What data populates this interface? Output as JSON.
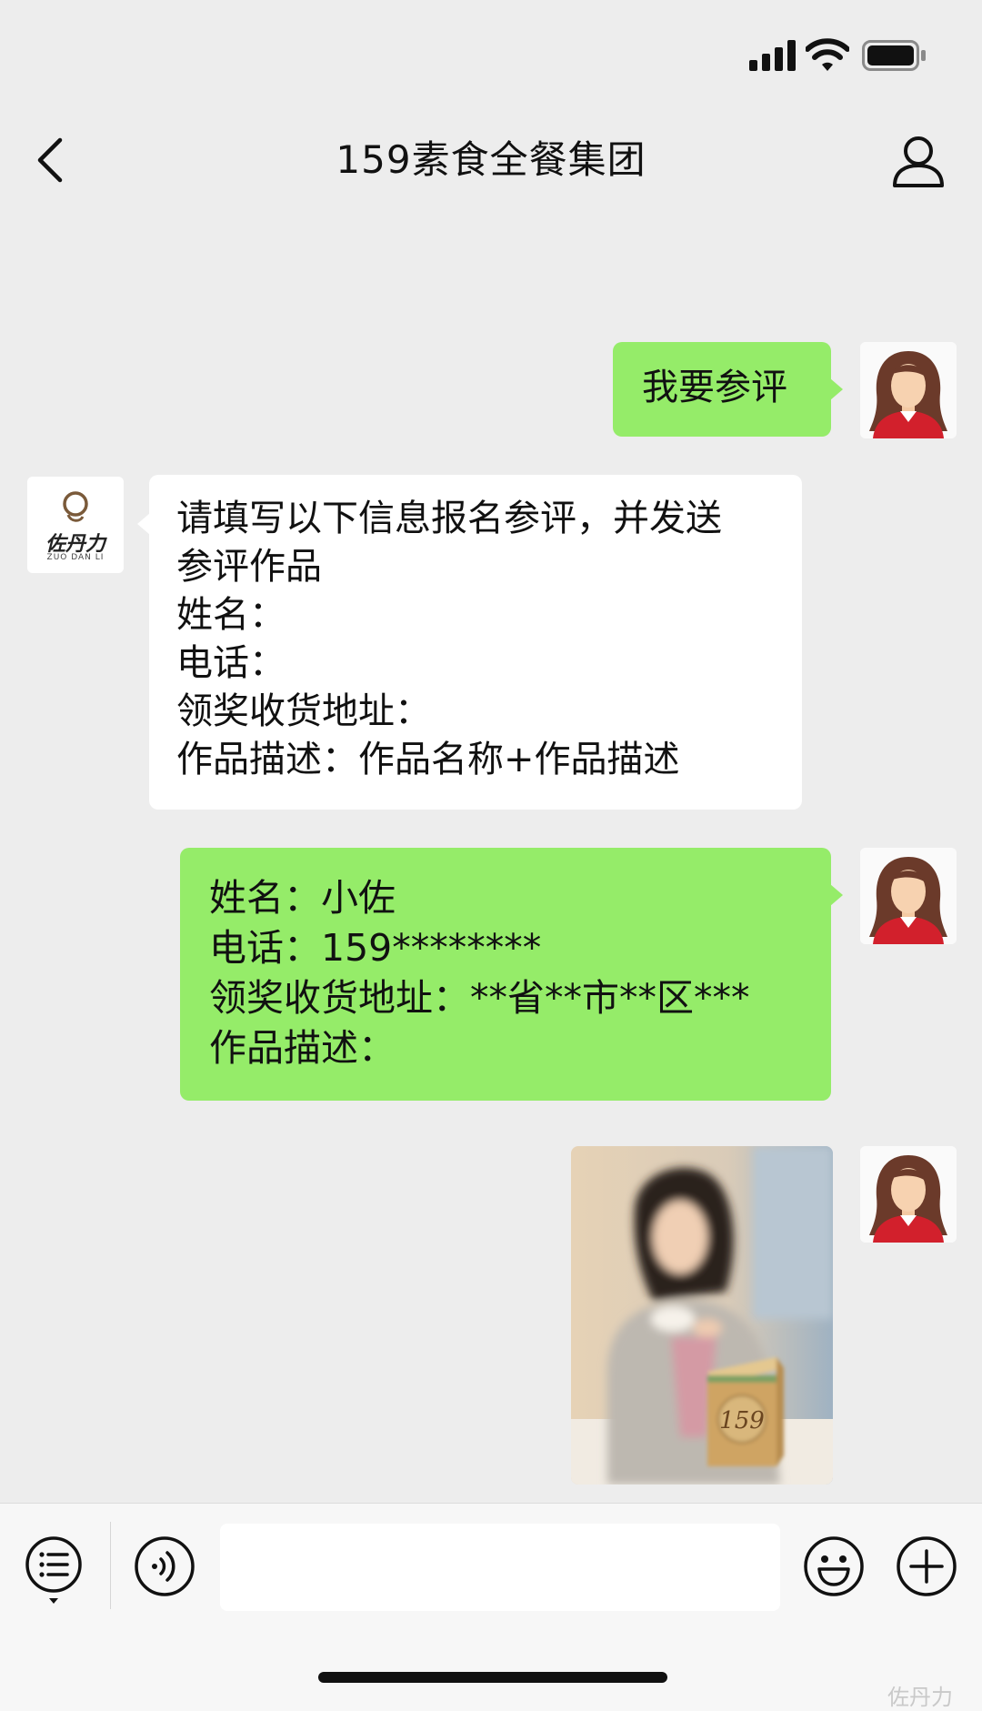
{
  "status_bar": {
    "signal": "signal-icon",
    "wifi": "wifi-icon",
    "battery": "battery-icon"
  },
  "header": {
    "title": "159素食全餐集团",
    "back_icon": "chevron-left-icon",
    "profile_icon": "person-icon"
  },
  "brand_avatar": {
    "text": "佐丹力",
    "subtext": "ZUO DAN LI"
  },
  "messages": [
    {
      "side": "right",
      "type": "text",
      "lines": [
        "我要参评"
      ]
    },
    {
      "side": "left",
      "type": "text",
      "lines": [
        "请填写以下信息报名参评，并发送",
        "参评作品",
        "姓名：",
        "电话：",
        "领奖收货地址：",
        "作品描述：作品名称+作品描述"
      ]
    },
    {
      "side": "right",
      "type": "text",
      "lines": [
        "姓名：小佐",
        "电话：159********",
        "领奖收货地址：**省**市**区***",
        "作品描述："
      ]
    },
    {
      "side": "right",
      "type": "image",
      "product_label": "159"
    }
  ],
  "input_bar": {
    "menu_icon": "list-menu-icon",
    "voice_icon": "voice-icon",
    "emoji_icon": "emoji-icon",
    "plus_icon": "plus-icon"
  },
  "watermark": "佐丹力",
  "colors": {
    "background": "#ededed",
    "outgoing_bubble": "#95ec69",
    "incoming_bubble": "#ffffff"
  }
}
